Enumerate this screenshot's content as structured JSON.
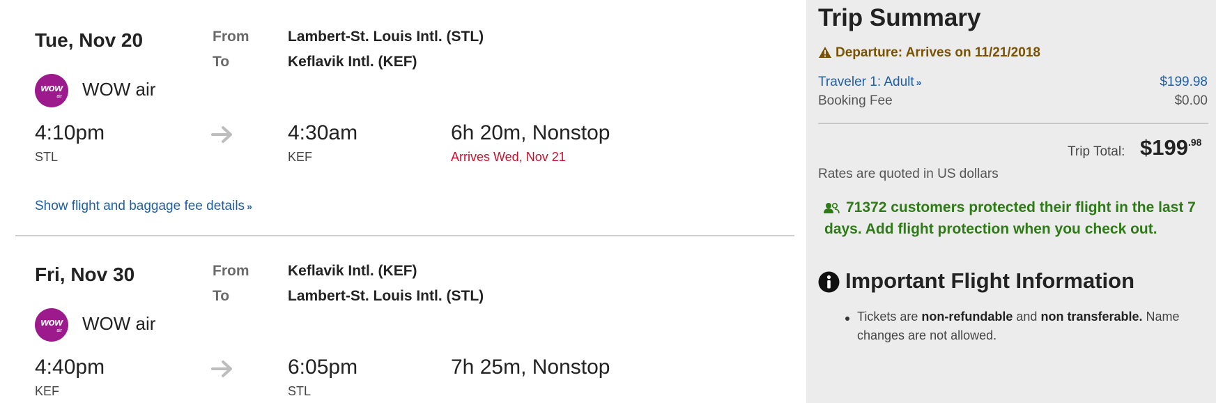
{
  "flights": [
    {
      "date": "Tue, Nov 20",
      "from_label": "From",
      "to_label": "To",
      "from_airport": "Lambert-St. Louis Intl. (STL)",
      "to_airport": "Keflavik Intl. (KEF)",
      "airline": "WOW air",
      "logo_text": "wow",
      "logo_sub": "air",
      "depart_time": "4:10pm",
      "depart_code": "STL",
      "arrive_time": "4:30am",
      "arrive_code": "KEF",
      "duration": "6h 20m, Nonstop",
      "arrives_note": "Arrives Wed, Nov 21",
      "details_link": "Show flight and baggage fee details"
    },
    {
      "date": "Fri, Nov 30",
      "from_label": "From",
      "to_label": "To",
      "from_airport": "Keflavik Intl. (KEF)",
      "to_airport": "Lambert-St. Louis Intl. (STL)",
      "airline": "WOW air",
      "logo_text": "wow",
      "logo_sub": "air",
      "depart_time": "4:40pm",
      "depart_code": "KEF",
      "arrive_time": "6:05pm",
      "arrive_code": "STL",
      "duration": "7h 25m, Nonstop"
    }
  ],
  "summary": {
    "title": "Trip Summary",
    "departure_warning": "Departure: Arrives on 11/21/2018",
    "traveler_label": "Traveler 1: Adult",
    "traveler_price": "$199.98",
    "booking_fee_label": "Booking Fee",
    "booking_fee_value": "$0.00",
    "total_label": "Trip Total:",
    "total_dollars": "$199",
    "total_cents": ".98",
    "rates_note": "Rates are quoted in US dollars",
    "protection_count": "71372",
    "protection_text": "customers protected their flight in the last 7 days. Add flight protection when you check out."
  },
  "important_info": {
    "title": "Important Flight Information",
    "text_1": "Tickets are",
    "bold_1": "non-refundable",
    "text_2": "and",
    "bold_2": "non transferable.",
    "text_3": "Name changes are not allowed."
  },
  "colors": {
    "link": "#1f5fa8",
    "arrives_red": "#c8102e",
    "warning_brown": "#7a5200",
    "protect_green": "#2e7a16",
    "wow_purple": "#9c1a8c",
    "sidebar_bg": "#ececec"
  },
  "icons": [
    "wow-air-logo",
    "arrow-right-icon",
    "chevron-down-icon",
    "warning-icon",
    "users-icon",
    "info-icon"
  ]
}
